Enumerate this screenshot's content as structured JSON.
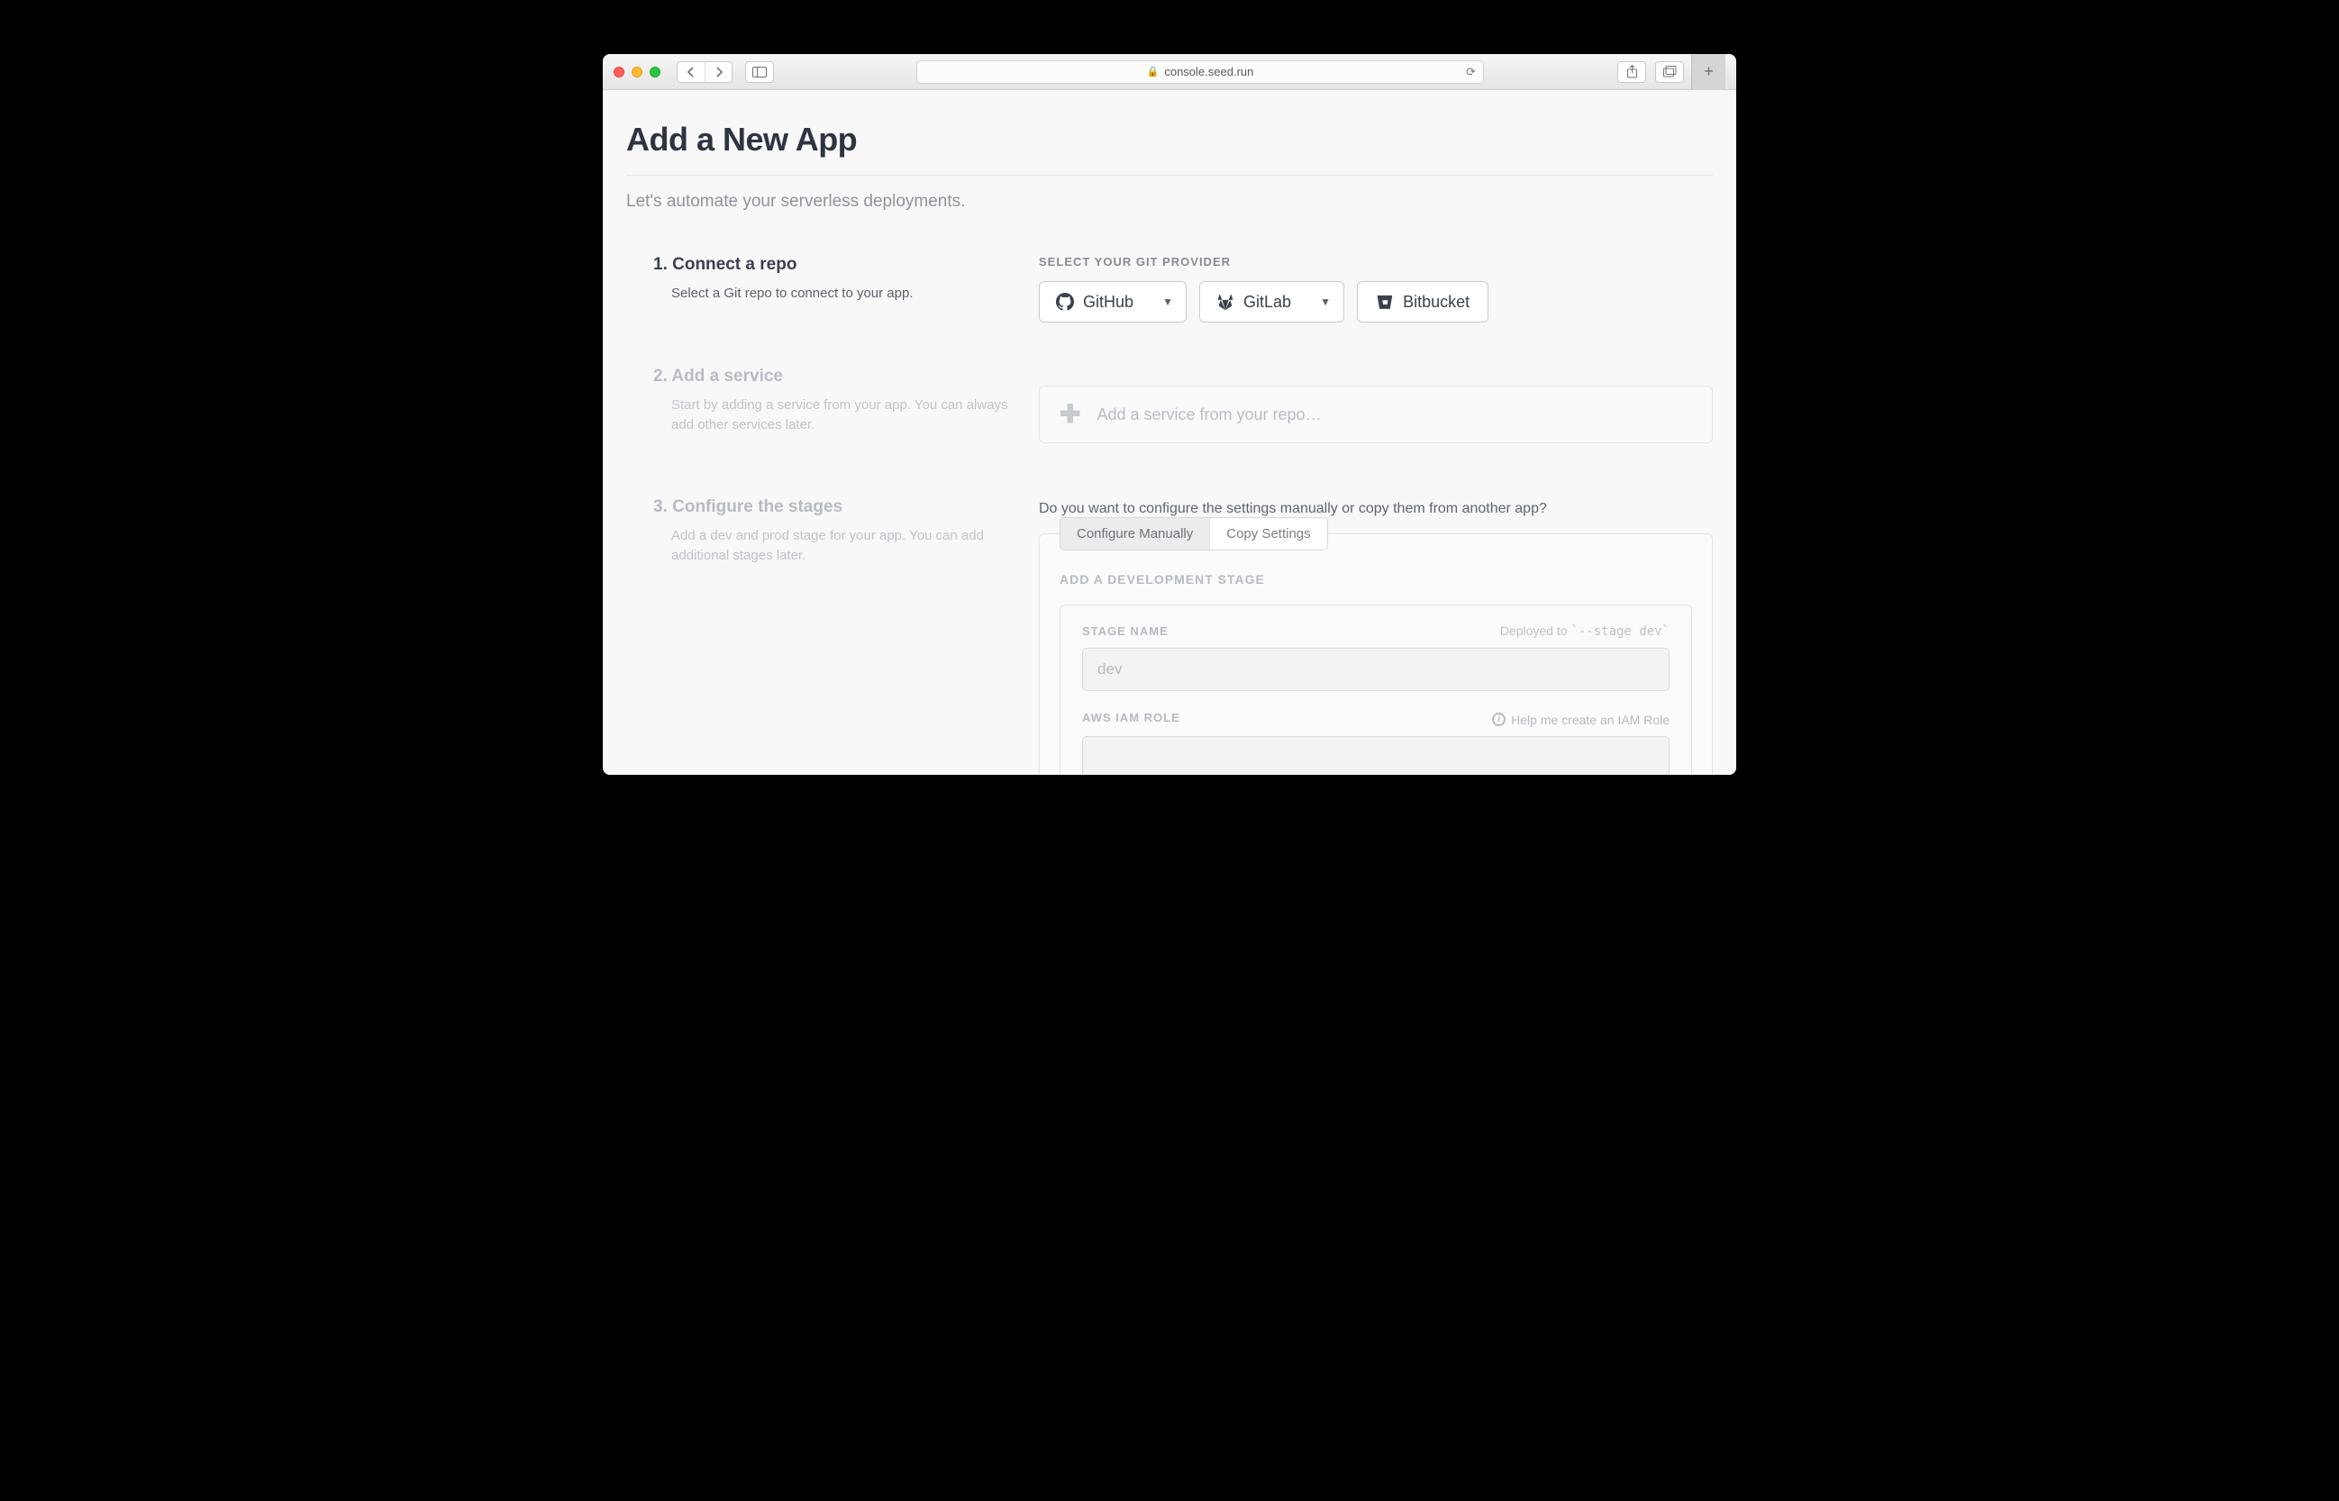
{
  "browser": {
    "url": "console.seed.run"
  },
  "page": {
    "title": "Add a New App",
    "subtitle": "Let's automate your serverless deployments."
  },
  "steps": {
    "s1": {
      "title": "1. Connect a repo",
      "desc": "Select a Git repo to connect to your app."
    },
    "s2": {
      "title": "2. Add a service",
      "desc": "Start by adding a service from your app. You can always add other services later."
    },
    "s3": {
      "title": "3. Configure the stages",
      "desc": "Add a dev and prod stage for your app. You can add additional stages later."
    }
  },
  "providers": {
    "label": "SELECT YOUR GIT PROVIDER",
    "github": "GitHub",
    "gitlab": "GitLab",
    "bitbucket": "Bitbucket"
  },
  "service": {
    "placeholder": "Add a service from your repo…"
  },
  "configure": {
    "question": "Do you want to configure the settings manually or copy them from another app?",
    "tab_manual": "Configure Manually",
    "tab_copy": "Copy Settings",
    "dev_heading": "ADD A DEVELOPMENT STAGE",
    "stage_name_label": "STAGE NAME",
    "deployed_to": "Deployed to ",
    "deployed_to_code": "`--stage dev`",
    "stage_name_placeholder": "dev",
    "iam_label": "AWS IAM ROLE",
    "iam_help": "Help me create an IAM Role"
  }
}
